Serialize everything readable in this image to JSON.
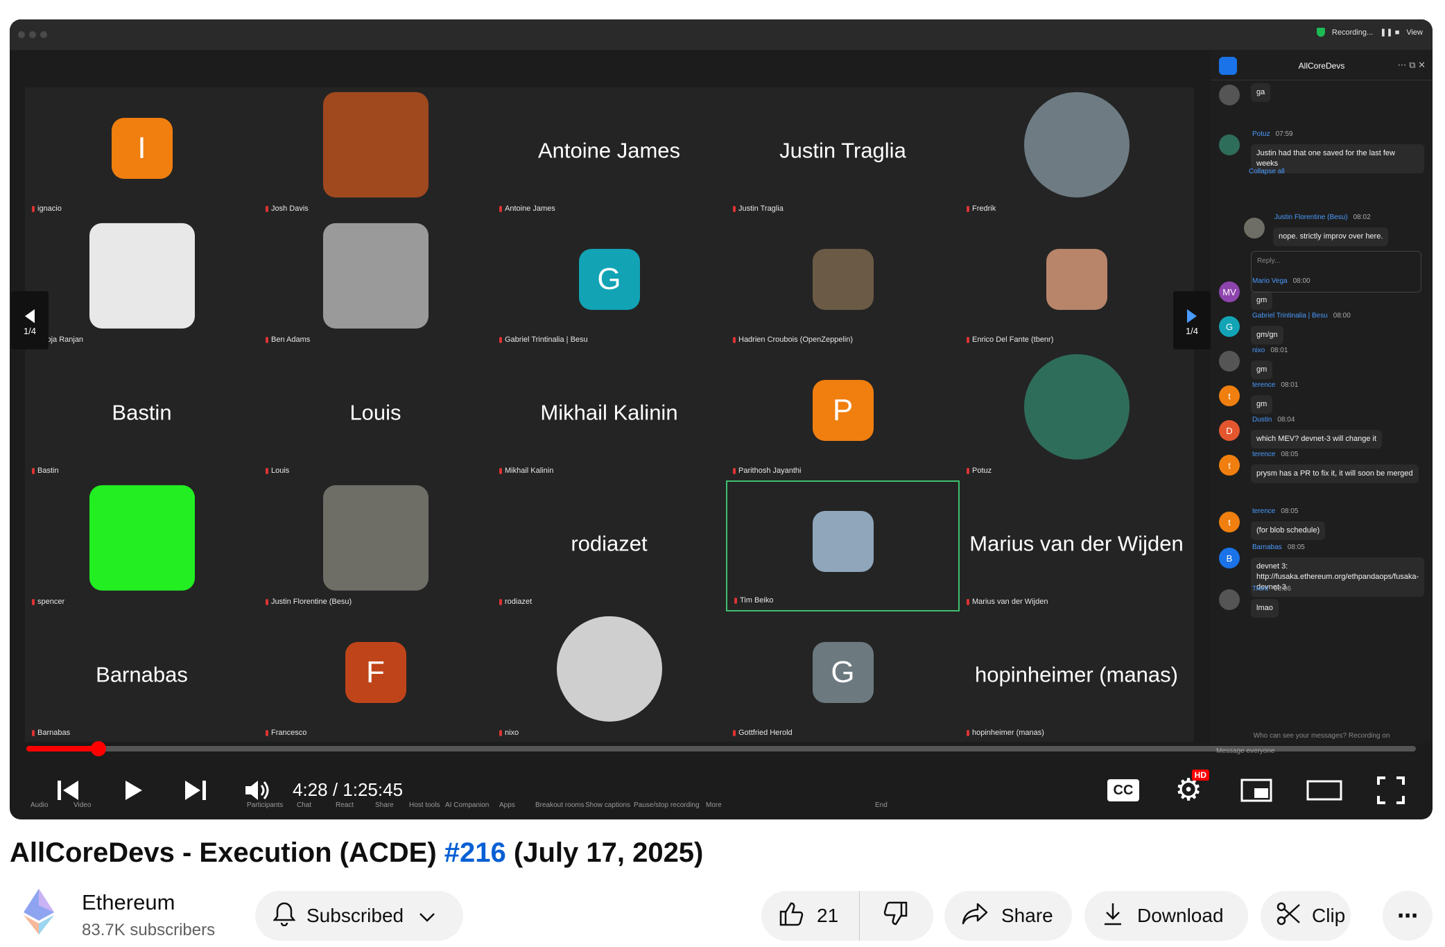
{
  "zoom": {
    "recording_label": "Recording...",
    "view_label": "View"
  },
  "tiles": [
    {
      "name": "ignacio",
      "big": "",
      "avatar": "I",
      "color": "#f07f0f"
    },
    {
      "name": "Josh Davis",
      "big": "",
      "avatar": "",
      "color": "#a0491e"
    },
    {
      "name": "Antoine James",
      "big": "Antoine James",
      "avatar": "",
      "color": ""
    },
    {
      "name": "Justin Traglia",
      "big": "Justin Traglia",
      "avatar": "",
      "color": ""
    },
    {
      "name": "Fredrik",
      "big": "",
      "avatar": "",
      "color": "#6e7b83"
    },
    {
      "name": "Pooja Ranjan",
      "big": "",
      "avatar": "",
      "color": "#e8e8e8"
    },
    {
      "name": "Ben Adams",
      "big": "",
      "avatar": "",
      "color": "#9a9a9a"
    },
    {
      "name": "Gabriel Trintinalia | Besu",
      "big": "",
      "avatar": "G",
      "color": "#12a3b5"
    },
    {
      "name": "Hadrien Croubois (OpenZeppelin)",
      "big": "",
      "avatar": "",
      "color": "#6b5a45"
    },
    {
      "name": "Enrico Del Fante (tbenr)",
      "big": "",
      "avatar": "",
      "color": "#b8856a"
    },
    {
      "name": "Bastin",
      "big": "Bastin",
      "avatar": "",
      "color": ""
    },
    {
      "name": "Louis",
      "big": "Louis",
      "avatar": "",
      "color": ""
    },
    {
      "name": "Mikhail Kalinin",
      "big": "Mikhail Kalinin",
      "avatar": "",
      "color": ""
    },
    {
      "name": "Parithosh Jayanthi",
      "big": "",
      "avatar": "P",
      "color": "#f07f0f"
    },
    {
      "name": "Potuz",
      "big": "",
      "avatar": "",
      "color": "#2f6d5b"
    },
    {
      "name": "spencer",
      "big": "",
      "avatar": "",
      "color": "#22ee22"
    },
    {
      "name": "Justin Florentine (Besu)",
      "big": "",
      "avatar": "",
      "color": "#6e6e66"
    },
    {
      "name": "rodiazet",
      "big": "rodiazet",
      "avatar": "",
      "color": ""
    },
    {
      "name": "Tim Beiko",
      "big": "",
      "avatar": "",
      "color": "#8fa6bb"
    },
    {
      "name": "Marius van der Wijden",
      "big": "Marius van der Wijden",
      "avatar": "",
      "color": ""
    },
    {
      "name": "Barnabas",
      "big": "Barnabas",
      "avatar": "",
      "color": ""
    },
    {
      "name": "Francesco",
      "big": "",
      "avatar": "F",
      "color": "#c0441a"
    },
    {
      "name": "nixo",
      "big": "",
      "avatar": "",
      "color": "#cfcfcf"
    },
    {
      "name": "Gottfried Herold",
      "big": "",
      "avatar": "G",
      "color": "#6c7a80"
    },
    {
      "name": "hopinheimer (manas)",
      "big": "hopinheimer (manas)",
      "avatar": "",
      "color": ""
    }
  ],
  "gallery_nav": {
    "left_page": "1/4",
    "right_page": "1/4"
  },
  "chat": {
    "title": "AllCoreDevs",
    "messages": [
      {
        "author": "",
        "time": "",
        "text": "ga",
        "avatar": "",
        "color": "#555"
      },
      {
        "author": "Potuz",
        "time": "07:59",
        "text": "Justin had that one saved for the last few weeks",
        "avatar": "",
        "color": "#2f6d5b"
      },
      {
        "author": "Justin Florentine (Besu)",
        "time": "08:02",
        "text": "nope. strictly improv over here.",
        "avatar": "",
        "color": "#6e6e66"
      },
      {
        "author": "Mario Vega",
        "time": "08:00",
        "text": "gm",
        "avatar": "MV",
        "color": "#8e44ad"
      },
      {
        "author": "Gabriel Trintinalia | Besu",
        "time": "08:00",
        "text": "gm/gn",
        "avatar": "G",
        "color": "#12a3b5"
      },
      {
        "author": "nixo",
        "time": "08:01",
        "text": "gm",
        "avatar": "",
        "color": "#555"
      },
      {
        "author": "terence",
        "time": "08:01",
        "text": "gm",
        "avatar": "t",
        "color": "#f07f0f"
      },
      {
        "author": "Dustin",
        "time": "08:04",
        "text": "which MEV? devnet-3 will change it",
        "avatar": "D",
        "color": "#e4572e"
      },
      {
        "author": "terence",
        "time": "08:05",
        "text": "prysm has a PR to fix it, it will soon be merged",
        "avatar": "t",
        "color": "#f07f0f"
      },
      {
        "author": "terence",
        "time": "08:05",
        "text": "(for blob schedule)",
        "avatar": "t",
        "color": "#f07f0f"
      },
      {
        "author": "Barnabas",
        "time": "08:05",
        "text": "devnet 3: http://fusaka.ethereum.org/ethpandaops/fusaka-devnet-3",
        "avatar": "B",
        "color": "#1a73e8"
      },
      {
        "author": "Trent",
        "time": "08:06",
        "text": "lmao",
        "avatar": "",
        "color": "#555"
      }
    ],
    "collapse_all": "Collapse all",
    "reply_placeholder": "Reply...",
    "footer": "Who can see your messages? Recording on",
    "message_everyone": "Message everyone"
  },
  "player": {
    "current_time": "4:28",
    "duration": "1:25:45",
    "progress": 0.052,
    "hd_badge": "HD",
    "cc_label": "CC"
  },
  "zoom_toolbar": [
    "Audio",
    "Video",
    "Participants",
    "Chat",
    "React",
    "Share",
    "Host tools",
    "AI Companion",
    "Apps",
    "Breakout rooms",
    "Show captions",
    "Pause/stop recording",
    "More",
    "End"
  ],
  "video": {
    "title_pre": "AllCoreDevs - Execution (ACDE) ",
    "title_tag": "#216",
    "title_post": " (July 17, 2025)"
  },
  "channel": {
    "name": "Ethereum",
    "subscribers": "83.7K subscribers"
  },
  "actions": {
    "subscribed": "Subscribed",
    "likes": "21",
    "share": "Share",
    "download": "Download",
    "clip": "Clip"
  }
}
